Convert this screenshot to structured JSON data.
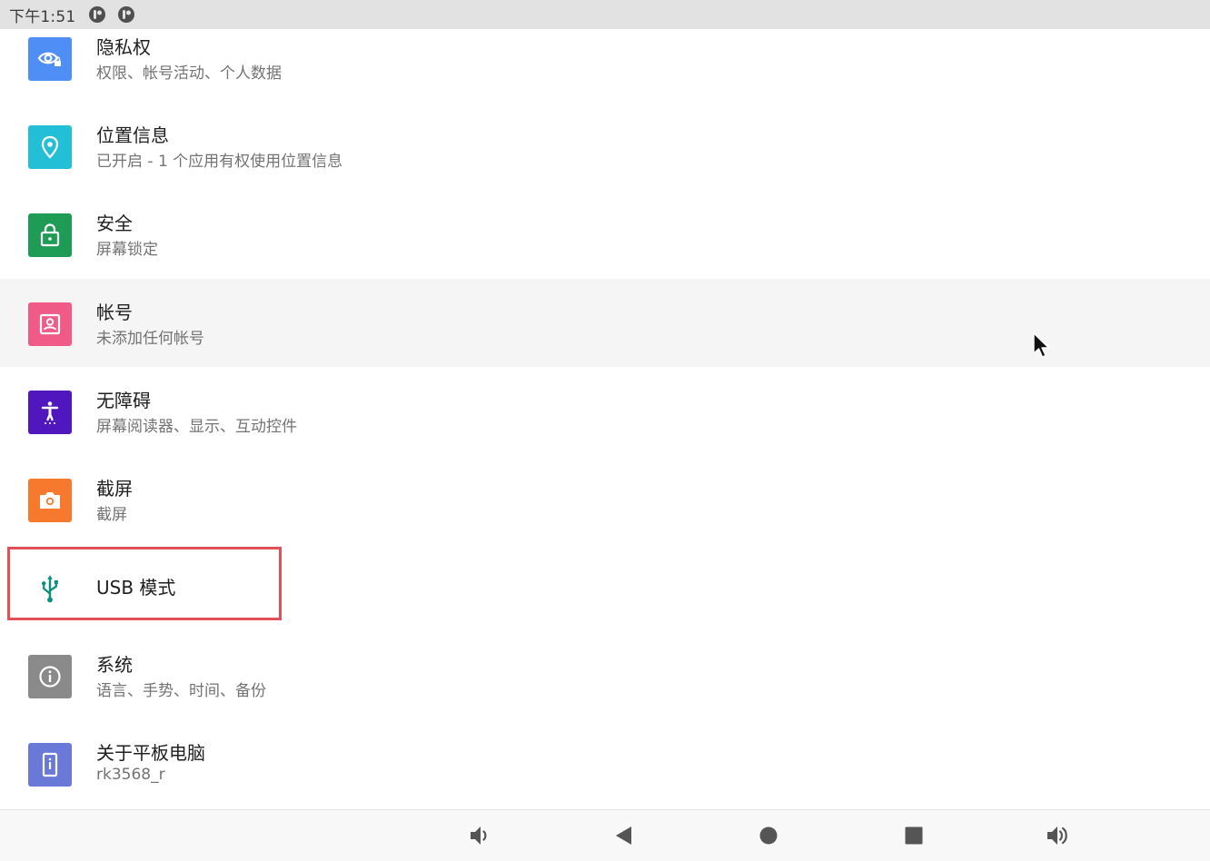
{
  "status_bar": {
    "time": "下午1:51",
    "icons": [
      "notification-app-icon",
      "notification-app-icon"
    ]
  },
  "settings": {
    "items": [
      {
        "title": "隐私权",
        "summary": "权限、帐号活动、个人数据",
        "icon": "privacy-eye-icon",
        "color": "#4f8ef5"
      },
      {
        "title": "位置信息",
        "summary": "已开启 - 1 个应用有权使用位置信息",
        "icon": "location-pin-icon",
        "color": "#23bfd6"
      },
      {
        "title": "安全",
        "summary": "屏幕锁定",
        "icon": "lock-icon",
        "color": "#1e9c56"
      },
      {
        "title": "帐号",
        "summary": "未添加任何帐号",
        "icon": "account-box-icon",
        "color": "#ef5a86"
      },
      {
        "title": "无障碍",
        "summary": "屏幕阅读器、显示、互动控件",
        "icon": "accessibility-icon",
        "color": "#4f17bd"
      },
      {
        "title": "截屏",
        "summary": "截屏",
        "icon": "camera-icon",
        "color": "#f7792e"
      },
      {
        "title": "USB 模式",
        "summary": "",
        "icon": "usb-icon",
        "color": "#0e8f80"
      },
      {
        "title": "系统",
        "summary": "语言、手势、时间、备份",
        "icon": "info-icon",
        "color": "#8a8a8a"
      },
      {
        "title": "关于平板电脑",
        "summary": "rk3568_r",
        "icon": "tablet-info-icon",
        "color": "#6a79d8"
      }
    ]
  },
  "nav_bar": {
    "buttons": [
      "volume-down-icon",
      "back-icon",
      "home-icon",
      "recents-icon",
      "volume-up-icon"
    ]
  }
}
